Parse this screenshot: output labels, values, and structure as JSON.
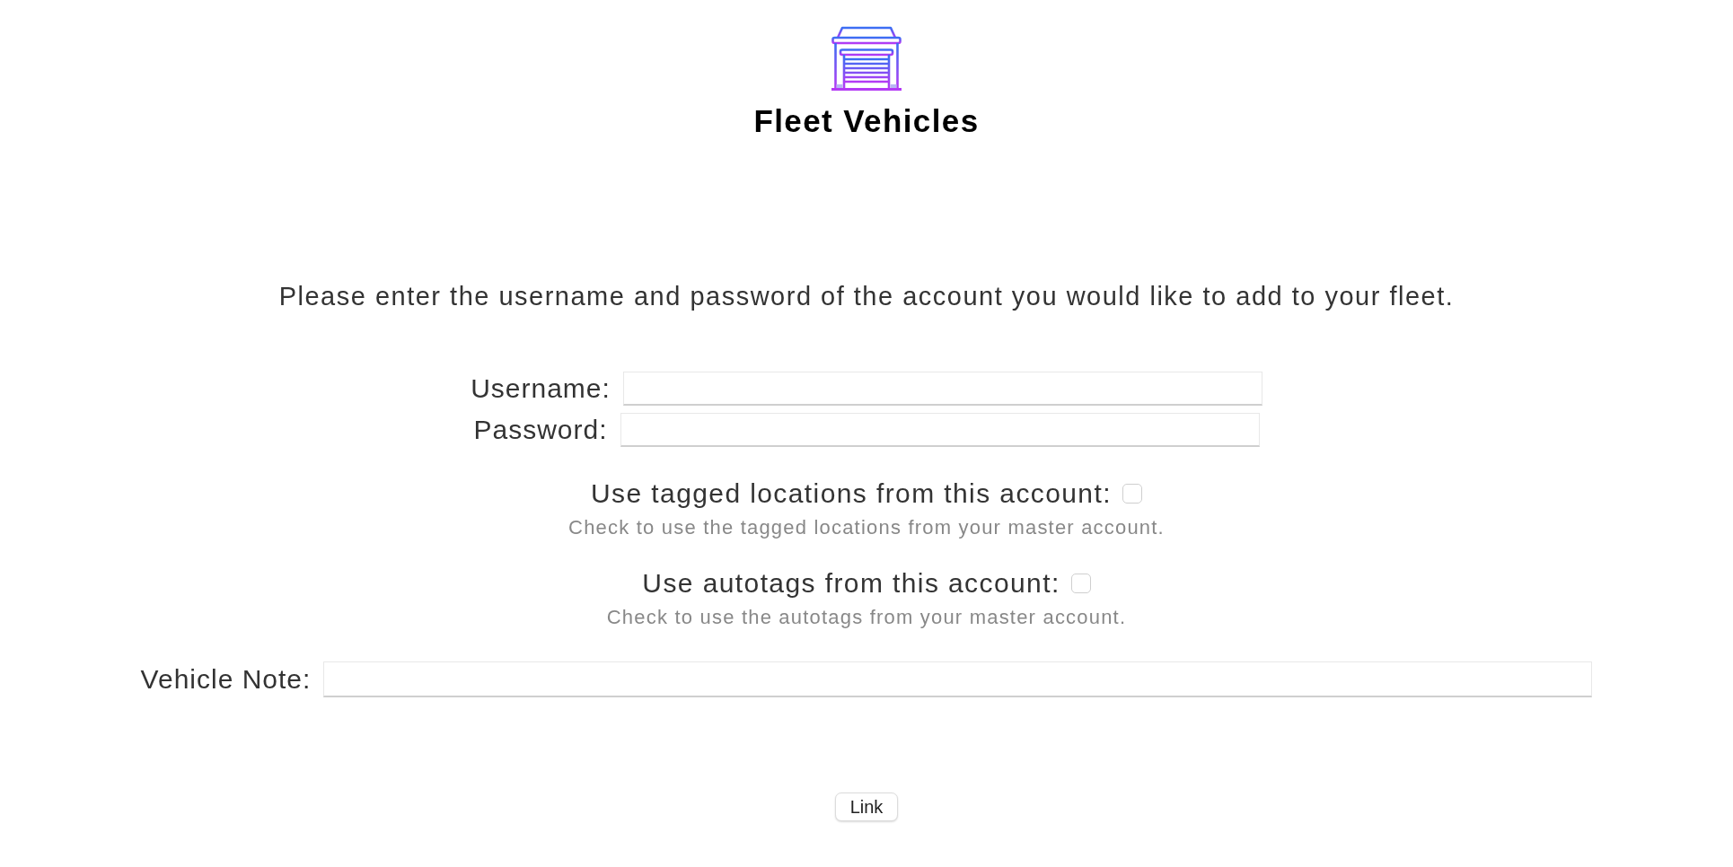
{
  "header": {
    "title": "Fleet Vehicles"
  },
  "instructions": "Please enter the username and password of the account you would like to add to your fleet.",
  "credentials": [
    {
      "label": "Username:"
    },
    {
      "label": "Password:"
    }
  ],
  "options": [
    {
      "label": "Use tagged locations from this account:",
      "checked": false,
      "hint": "Check to use the tagged locations from your master account."
    },
    {
      "label": "Use autotags from this account:",
      "checked": false,
      "hint": "Check to use the autotags from your master account."
    }
  ],
  "note": {
    "label": "Vehicle Note:"
  },
  "buttons": [
    {
      "label": "Link"
    }
  ]
}
